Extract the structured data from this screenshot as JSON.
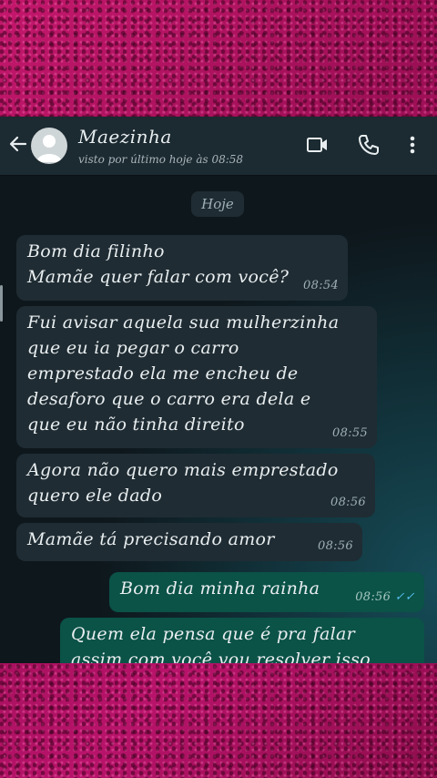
{
  "header": {
    "contact_name": "Maezinha",
    "status": "visto por último hoje às 08:58"
  },
  "date_chip": "Hoje",
  "messages": [
    {
      "direction": "in",
      "lines": [
        "Bom dia filinho",
        "Mamãe quer falar com você?"
      ],
      "time": "08:54"
    },
    {
      "direction": "in",
      "lines": [
        "Fui avisar aquela sua mulherzinha",
        "que eu ia pegar o carro",
        "emprestado ela me encheu de",
        "desaforo que o carro era dela e",
        "que eu não tinha direito"
      ],
      "time": "08:55"
    },
    {
      "direction": "in",
      "lines": [
        "Agora não quero mais emprestado",
        "quero ele dado"
      ],
      "time": "08:56"
    },
    {
      "direction": "in",
      "lines": [
        "Mamãe tá precisando amor"
      ],
      "time": "08:56"
    },
    {
      "direction": "out",
      "lines": [
        "Bom dia minha rainha"
      ],
      "time": "08:56",
      "status": "read"
    },
    {
      "direction": "out",
      "lines": [
        "Quem ela pensa que é pra falar",
        "assim com você vou resolver isso"
      ],
      "time": ""
    }
  ],
  "icons": {
    "back": "arrow-left-icon",
    "avatar": "person-icon",
    "video": "video-camera-icon",
    "call": "phone-icon",
    "menu": "more-vertical-icon",
    "read": "double-check-icon"
  },
  "colors": {
    "background": "#b0115f",
    "chat_bg": "#0e171c",
    "header": "#1c2a31",
    "incoming": "#1f2c33",
    "outgoing": "#0b5247",
    "read_ticks": "#53bdeb"
  }
}
